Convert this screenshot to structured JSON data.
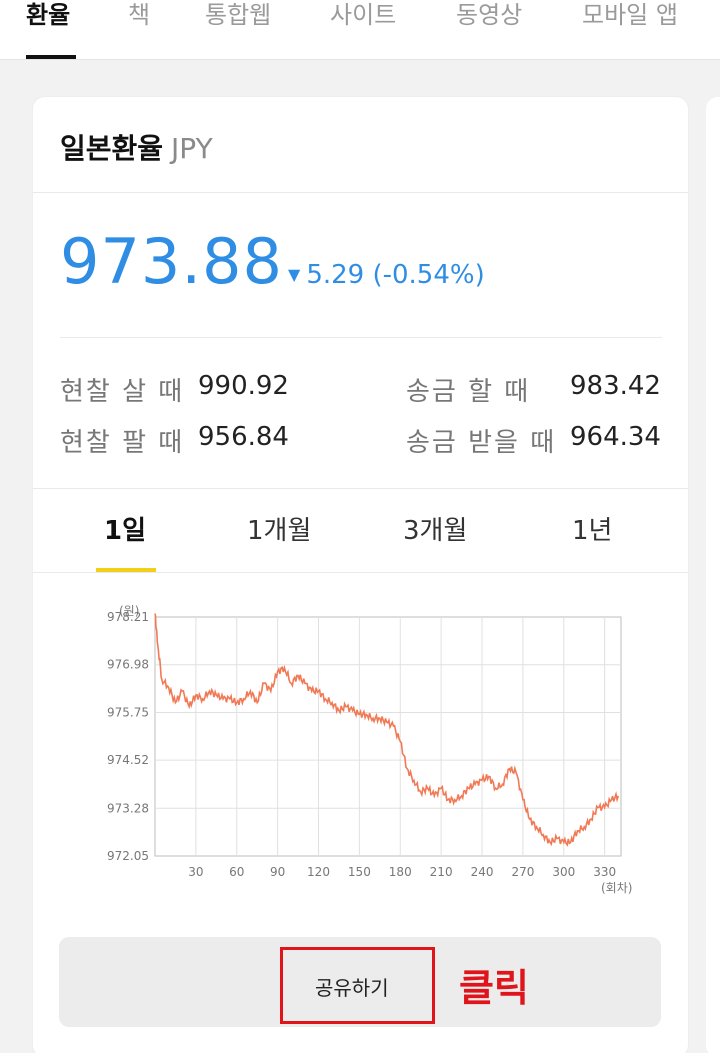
{
  "nav": {
    "tabs": [
      {
        "label": "환율",
        "active": true
      },
      {
        "label": "책"
      },
      {
        "label": "통합웹"
      },
      {
        "label": "사이트"
      },
      {
        "label": "동영상"
      },
      {
        "label": "모바일 앱"
      }
    ]
  },
  "card": {
    "title": "일본환율",
    "code": "JPY",
    "price": "973.88",
    "change_arrow": "▼",
    "change": "5.29 (-0.54%)",
    "rates": {
      "cash_buy_label": "현찰 살 때",
      "cash_buy_value": "990.92",
      "cash_sell_label": "현찰 팔 때",
      "cash_sell_value": "956.84",
      "send_label": "송금 할 때",
      "send_value": "983.42",
      "receive_label": "송금 받을 때",
      "receive_value": "964.34"
    },
    "periods": [
      {
        "label": "1일",
        "active": true
      },
      {
        "label": "1개월"
      },
      {
        "label": "3개월"
      },
      {
        "label": "1년"
      }
    ],
    "share_label": "공유하기",
    "click_annotation": "클릭"
  },
  "colors": {
    "accent": "#2f8de4",
    "line": "#f07a55",
    "active_underline": "#f2d01a",
    "annotation": "#e0141b"
  },
  "chart_data": {
    "type": "line",
    "ylabel": "(원)",
    "xlabel": "(회차)",
    "yticks": [
      "978.21",
      "976.98",
      "975.75",
      "974.52",
      "973.28",
      "972.05"
    ],
    "xticks": [
      "30",
      "60",
      "90",
      "120",
      "150",
      "180",
      "210",
      "240",
      "270",
      "300",
      "330"
    ],
    "ylim": [
      972.05,
      978.21
    ],
    "xlim": [
      0,
      342
    ],
    "grid": true,
    "series": [
      {
        "x": [
          0,
          2,
          5,
          10,
          15,
          20,
          25,
          30,
          35,
          40,
          45,
          50,
          55,
          60,
          65,
          70,
          75,
          80,
          85,
          90,
          95,
          100,
          105,
          110,
          115,
          120,
          125,
          130,
          135,
          140,
          145,
          150,
          155,
          160,
          165,
          170,
          175,
          180,
          185,
          190,
          195,
          200,
          205,
          210,
          215,
          220,
          225,
          230,
          235,
          240,
          245,
          250,
          255,
          260,
          265,
          270,
          275,
          280,
          285,
          290,
          295,
          300,
          305,
          310,
          315,
          320,
          325,
          330,
          335,
          340
        ],
        "values": [
          978.3,
          977.5,
          976.6,
          976.4,
          976.0,
          976.3,
          975.9,
          976.2,
          976.1,
          976.3,
          976.2,
          976.1,
          976.1,
          976.0,
          976.1,
          976.3,
          976.0,
          976.5,
          976.3,
          976.8,
          976.9,
          976.5,
          976.7,
          976.5,
          976.3,
          976.3,
          976.1,
          976.0,
          975.8,
          975.9,
          975.8,
          975.7,
          975.7,
          975.6,
          975.6,
          975.5,
          975.4,
          975.0,
          974.3,
          974.0,
          973.7,
          973.8,
          973.6,
          973.8,
          973.5,
          973.5,
          973.6,
          973.8,
          973.9,
          974.0,
          974.1,
          973.8,
          973.9,
          974.3,
          974.2,
          973.5,
          973.0,
          972.8,
          972.6,
          972.4,
          972.5,
          972.4,
          972.4,
          972.7,
          972.8,
          973.0,
          973.3,
          973.3,
          973.5,
          973.6
        ]
      }
    ]
  }
}
